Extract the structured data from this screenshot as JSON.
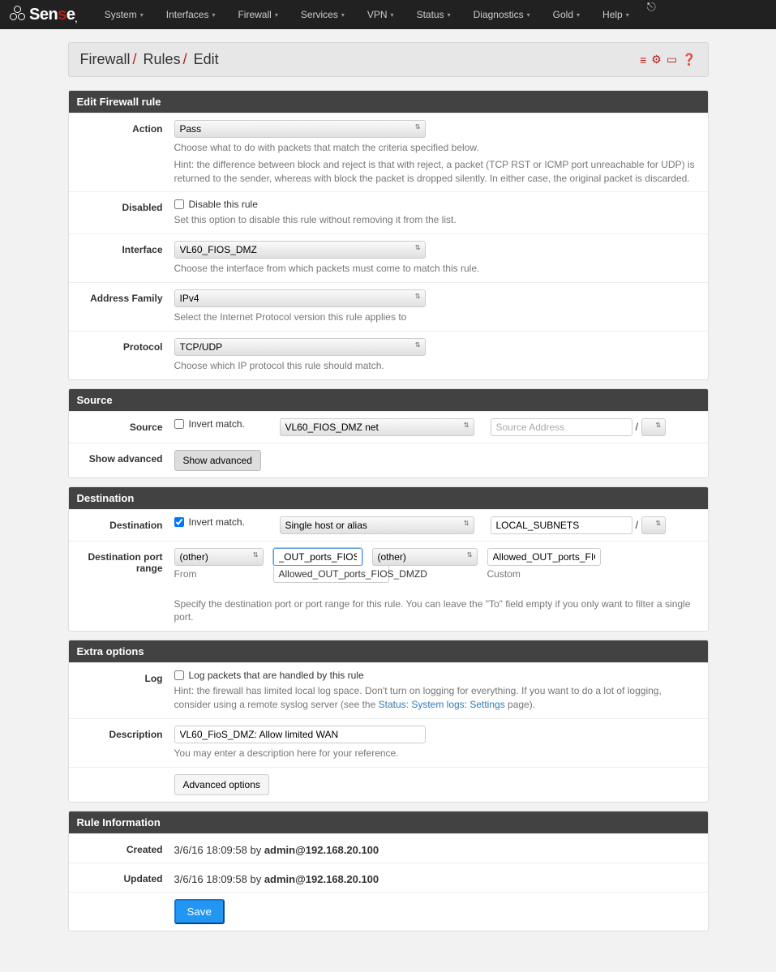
{
  "brand": "Sense",
  "nav": [
    "System",
    "Interfaces",
    "Firewall",
    "Services",
    "VPN",
    "Status",
    "Diagnostics",
    "Gold",
    "Help"
  ],
  "breadcrumb": [
    "Firewall",
    "Rules",
    "Edit"
  ],
  "panels": {
    "edit": "Edit Firewall rule",
    "source": "Source",
    "destination": "Destination",
    "extra": "Extra options",
    "ruleinfo": "Rule Information"
  },
  "labels": {
    "action": "Action",
    "disabled": "Disabled",
    "interface": "Interface",
    "addrfam": "Address Family",
    "protocol": "Protocol",
    "source": "Source",
    "showadv": "Show advanced",
    "destination": "Destination",
    "dport": "Destination port range",
    "log": "Log",
    "description": "Description",
    "created": "Created",
    "updated": "Updated"
  },
  "values": {
    "action": "Pass",
    "action_help": "Choose what to do with packets that match the criteria specified below.",
    "action_hint": "Hint: the difference between block and reject is that with reject, a packet (TCP RST or ICMP port unreachable for UDP) is returned to the sender, whereas with block the packet is dropped silently. In either case, the original packet is discarded.",
    "disable_label": "Disable this rule",
    "disable_help": "Set this option to disable this rule without removing it from the list.",
    "interface": "VL60_FIOS_DMZ",
    "interface_help": "Choose the interface from which packets must come to match this rule.",
    "addrfam": "IPv4",
    "addrfam_help": "Select the Internet Protocol version this rule applies to",
    "protocol": "TCP/UDP",
    "protocol_help": "Choose which IP protocol this rule should match.",
    "invert": "Invert match.",
    "source_type": "VL60_FIOS_DMZ net",
    "source_addr_ph": "Source Address",
    "slash": "/",
    "showadv_btn": "Show advanced",
    "dest_type": "Single host or alias",
    "dest_addr": "LOCAL_SUBNETS",
    "dport_from_sel": "(other)",
    "dport_from_txt": "_OUT_ports_FIOS_DMZ",
    "dport_autocomplete": "Allowed_OUT_ports_FIOS_DMZD",
    "dport_to_sel": "(other)",
    "dport_to_txt": "Allowed_OUT_ports_FIC",
    "from_lbl": "From",
    "custom_lbl": "Custom",
    "dport_help": "Specify the destination port or port range for this rule. You can leave the \"To\" field empty if you only want to filter a single port.",
    "log_label": "Log packets that are handled by this rule",
    "log_help_pre": "Hint: the firewall has limited local log space. Don't turn on logging for everything. If you want to do a lot of logging, consider using a remote syslog server (see the ",
    "log_link": "Status: System logs: Settings",
    "log_help_post": " page).",
    "description": "VL60_FioS_DMZ: Allow limited WAN",
    "description_help": "You may enter a description here for your reference.",
    "advopt_btn": "Advanced options",
    "created_val": "3/6/16 18:09:58 by ",
    "created_by": "admin@192.168.20.100",
    "updated_val": "3/6/16 18:09:58 by ",
    "updated_by": "admin@192.168.20.100",
    "save": "Save"
  }
}
